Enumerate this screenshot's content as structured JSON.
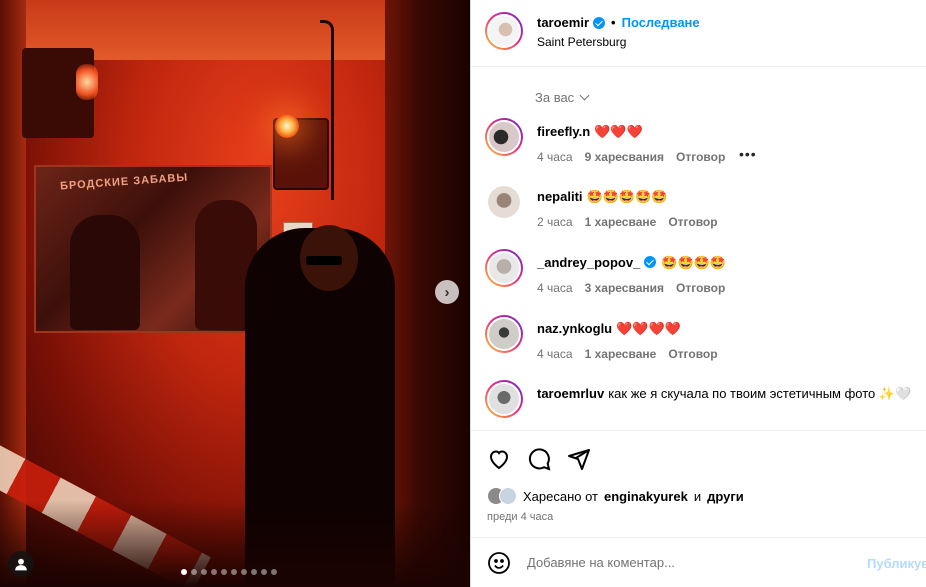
{
  "post": {
    "username": "taroemir",
    "follow_label": "Последване",
    "location": "Saint Petersburg",
    "photo_poster_title": "БРОДСКИЕ ЗАБАВЫ",
    "carousel_count": 10,
    "carousel_active_index": 0
  },
  "comments_sort_label": "За вас",
  "comments": [
    {
      "username": "fireefly.n",
      "text": "❤️❤️❤️",
      "time": "4 часа",
      "likes": "9 харесвания",
      "reply": "Отговор",
      "more": "•••",
      "verified": false,
      "ring": true
    },
    {
      "username": "nepaliti",
      "text": "🤩🤩🤩🤩🤩",
      "time": "2 часа",
      "likes": "1 харесване",
      "reply": "Отговор",
      "verified": false,
      "ring": false
    },
    {
      "username": "_andrey_popov_",
      "text": "🤩🤩🤩🤩",
      "time": "4 часа",
      "likes": "3 харесвания",
      "reply": "Отговор",
      "verified": true,
      "ring": true
    },
    {
      "username": "naz.ynkoglu",
      "text": "❤️❤️❤️❤️",
      "time": "4 часа",
      "likes": "1 харесване",
      "reply": "Отговор",
      "verified": false,
      "ring": true
    },
    {
      "username": "taroemrluv",
      "text": "как же я скучала по твоим эстетичным фото ✨🤍",
      "verified": false,
      "ring": true
    }
  ],
  "likes_line": {
    "prefix": "Харесано от",
    "user": "enginakyurek",
    "conj": "и",
    "others": "други"
  },
  "post_time": "преди 4 часа",
  "add_comment": {
    "placeholder": "Добавяне на коментар...",
    "post_label": "Публикуване"
  },
  "icons": {
    "like": "heart-icon",
    "comment": "comment-icon",
    "share": "share-icon",
    "emoji": "emoji-icon",
    "next": "chevron-right-icon",
    "tag": "user-tag-icon"
  },
  "colors": {
    "accent": "#0095f6",
    "secondary_text": "#737373",
    "disabled_post": "#b3dbff"
  }
}
